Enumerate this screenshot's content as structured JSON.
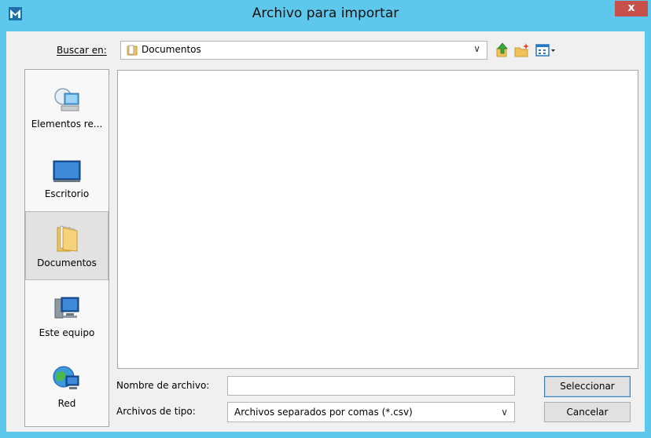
{
  "window": {
    "title": "Archivo para importar",
    "close_label": "x"
  },
  "lookin": {
    "label": "Buscar en:",
    "value": "Documentos"
  },
  "toolbar": {
    "icons": [
      "up-folder-icon",
      "new-folder-icon",
      "view-menu-icon"
    ]
  },
  "places": [
    {
      "label": "Elementos re...",
      "icon": "recent-items-icon"
    },
    {
      "label": "Escritorio",
      "icon": "desktop-icon"
    },
    {
      "label": "Documentos",
      "icon": "documents-folder-icon",
      "selected": true
    },
    {
      "label": "Este equipo",
      "icon": "computer-icon"
    },
    {
      "label": "Red",
      "icon": "network-icon"
    }
  ],
  "filename": {
    "label": "Nombre de archivo:",
    "value": ""
  },
  "filetype": {
    "label": "Archivos de tipo:",
    "value": "Archivos separados por comas (*.csv)"
  },
  "buttons": {
    "select": "Seleccionar",
    "cancel": "Cancelar"
  },
  "colors": {
    "title_bar": "#5ec8ec",
    "close": "#c7504a",
    "client": "#f0f0f0"
  }
}
